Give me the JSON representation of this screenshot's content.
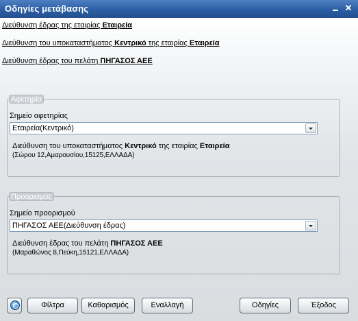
{
  "window": {
    "title": "Οδηγίες μετάβασης"
  },
  "links": [
    {
      "prefix": "Διεύθυνση έδρας της εταιρίας ",
      "bold1": "Εταιρεία",
      "middle": "",
      "bold2": ""
    },
    {
      "prefix": "Διεύθυνση του υποκαταστήματος ",
      "bold1": "Κεντρικό",
      "middle": " της εταιρίας ",
      "bold2": "Εταιρεία"
    },
    {
      "prefix": "Διεύθυνση έδρας του πελάτη ",
      "bold1": "ΠΗΓΑΣΟΣ ΑΕΕ",
      "middle": "",
      "bold2": ""
    }
  ],
  "origin": {
    "legend": "Αφετηρία",
    "field_label": "Σημείο αφετηρίας",
    "selected": "Εταιρεία(Κεντρικό)",
    "addr_prefix": "Διεύθυνση του υποκαταστήματος ",
    "addr_bold1": "Κεντρικό",
    "addr_middle": " της εταιρίας ",
    "addr_bold2": "Εταιρεία",
    "addr_detail": "(Σώρου 12,Αμαρουσίου,15125,ΕΛΛΑΔΑ)"
  },
  "destination": {
    "legend": "Προορισμός",
    "field_label": "Σημείο προορισμού",
    "selected": "ΠΗΓΑΣΟΣ ΑΕΕ(Διεύθυνση έδρας)",
    "addr_prefix": "Διεύθυνση έδρας του πελάτη ",
    "addr_bold1": "ΠΗΓΑΣΟΣ ΑΕΕ",
    "addr_detail": "(Μαραθώνος 8,Πεύκη,15121,ΕΛΛΑΔΑ)"
  },
  "buttons": {
    "filter": "Φίλτρα",
    "clear": "Καθαρισμός",
    "swap": "Εναλλαγή",
    "directions": "Οδηγίες",
    "exit": "Έξοδος"
  }
}
